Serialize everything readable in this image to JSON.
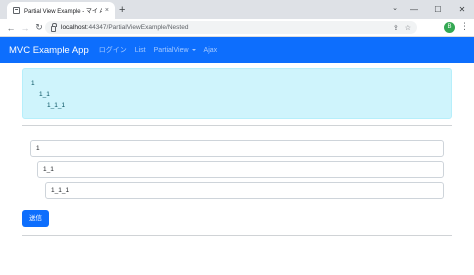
{
  "browser": {
    "tab_title": "Partial View Example - マイ ASP.N",
    "tab_close": "×",
    "new_tab": "+",
    "url_host": "localhost",
    "url_rest": ":44347/PartialViewExample/Nested",
    "profile_initial": "B",
    "window_controls": {
      "minimize": "—",
      "maximize": "☐",
      "close": "✕"
    }
  },
  "navbar": {
    "brand": "MVC Example App",
    "links": [
      "ログイン",
      "List",
      "PartialView",
      "Ajax"
    ]
  },
  "alert": {
    "lines": [
      "1",
      "1_1",
      "1_1_1"
    ]
  },
  "form": {
    "fields": [
      "1",
      "1_1",
      "1_1_1"
    ],
    "submit_label": "送信"
  },
  "colors": {
    "navbar": "#0d6efd",
    "alert_bg": "#cff4fc",
    "button": "#0d6efd"
  }
}
